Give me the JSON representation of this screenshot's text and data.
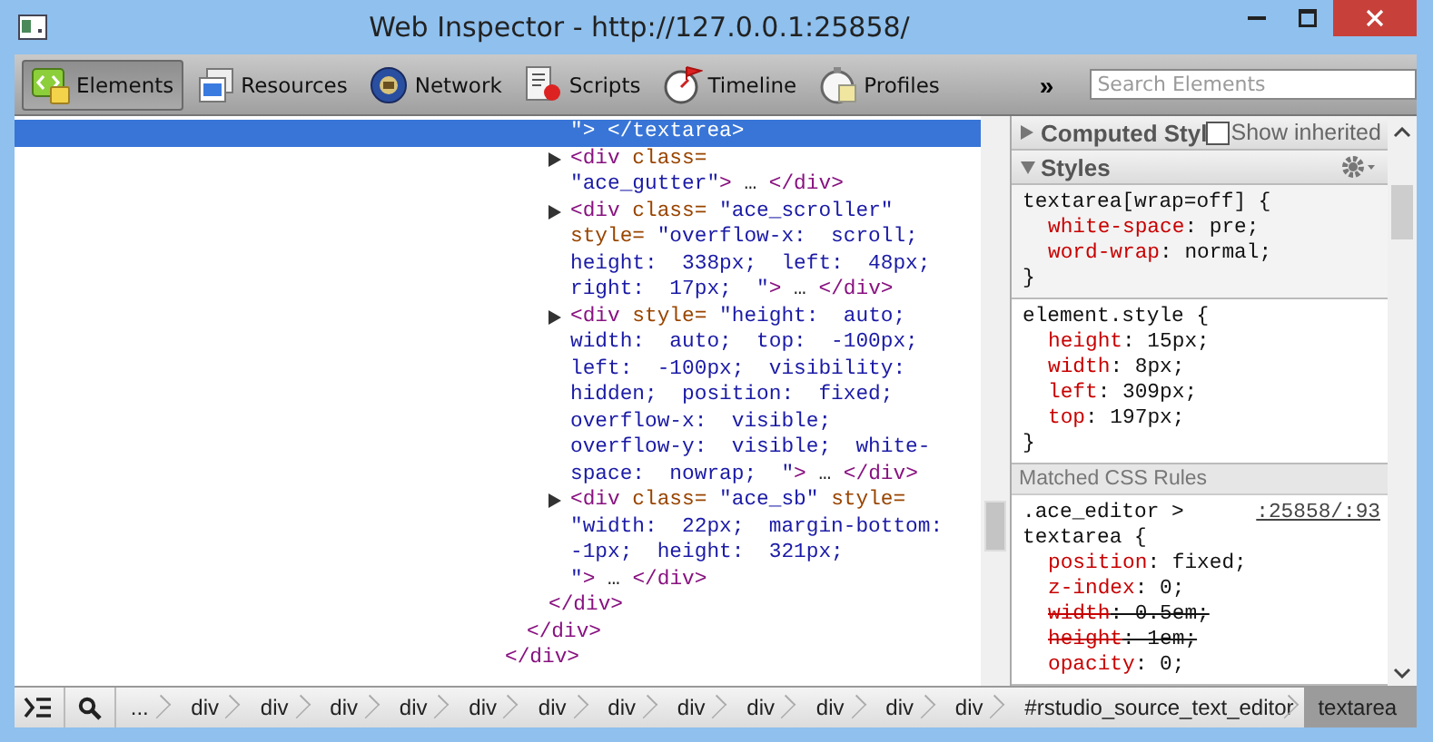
{
  "window": {
    "title": "Web Inspector - http://127.0.0.1:25858/"
  },
  "toolbar": {
    "tabs": [
      {
        "label": "Elements",
        "selected": true
      },
      {
        "label": "Resources",
        "selected": false
      },
      {
        "label": "Network",
        "selected": false
      },
      {
        "label": "Scripts",
        "selected": false
      },
      {
        "label": "Timeline",
        "selected": false
      },
      {
        "label": "Profiles",
        "selected": false
      }
    ],
    "overflow": "»",
    "search": {
      "placeholder": "Search Elements"
    }
  },
  "dom_tree": {
    "close": [
      {
        "kind": "tag",
        "text": "</div>"
      }
    ],
    "children": [
      {
        "close": [
          {
            "kind": "tag",
            "text": "</div>"
          }
        ],
        "children": [
          {
            "close": [
              {
                "kind": "tag",
                "text": "</div>"
              }
            ],
            "children": [
              {
                "selected": true,
                "lines": [
                  [
                    {
                      "kind": "value",
                      "text": "\""
                    },
                    {
                      "kind": "tag",
                      "text": "> </textarea>"
                    }
                  ]
                ]
              },
              {
                "selected": false,
                "expanded": false,
                "lines": [
                  [
                    {
                      "kind": "tag",
                      "text": "<div"
                    },
                    {
                      "kind": "attr",
                      "text": " class="
                    }
                  ],
                  [
                    {
                      "kind": "value",
                      "text": "\"ace_gutter\""
                    },
                    {
                      "kind": "tag",
                      "text": ">"
                    },
                    {
                      "kind": "text",
                      "text": " … "
                    },
                    {
                      "kind": "tag",
                      "text": "</div>"
                    }
                  ]
                ]
              },
              {
                "selected": false,
                "expanded": false,
                "lines": [
                  [
                    {
                      "kind": "tag",
                      "text": "<div"
                    },
                    {
                      "kind": "attr",
                      "text": " class="
                    },
                    {
                      "kind": "value",
                      "text": " \"ace_scroller\""
                    }
                  ],
                  [
                    {
                      "kind": "attr",
                      "text": "style="
                    },
                    {
                      "kind": "value",
                      "text": " \"overflow-x:  scroll;"
                    }
                  ],
                  [
                    {
                      "kind": "value",
                      "text": "height:  338px;  left:  48px;"
                    }
                  ],
                  [
                    {
                      "kind": "value",
                      "text": "right:  17px;  \""
                    },
                    {
                      "kind": "tag",
                      "text": ">"
                    },
                    {
                      "kind": "text",
                      "text": " … "
                    },
                    {
                      "kind": "tag",
                      "text": "</div>"
                    }
                  ]
                ]
              },
              {
                "selected": false,
                "expanded": false,
                "lines": [
                  [
                    {
                      "kind": "tag",
                      "text": "<div"
                    },
                    {
                      "kind": "attr",
                      "text": " style="
                    },
                    {
                      "kind": "value",
                      "text": " \"height:  auto;"
                    }
                  ],
                  [
                    {
                      "kind": "value",
                      "text": "width:  auto;  top:  -100px;"
                    }
                  ],
                  [
                    {
                      "kind": "value",
                      "text": "left:  -100px;  visibility:"
                    }
                  ],
                  [
                    {
                      "kind": "value",
                      "text": "hidden;  position:  fixed;"
                    }
                  ],
                  [
                    {
                      "kind": "value",
                      "text": "overflow-x:  visible;"
                    }
                  ],
                  [
                    {
                      "kind": "value",
                      "text": "overflow-y:  visible;  white-"
                    }
                  ],
                  [
                    {
                      "kind": "value",
                      "text": "space:  nowrap;  \""
                    },
                    {
                      "kind": "tag",
                      "text": ">"
                    },
                    {
                      "kind": "text",
                      "text": " … "
                    },
                    {
                      "kind": "tag",
                      "text": "</div>"
                    }
                  ]
                ]
              },
              {
                "selected": false,
                "expanded": false,
                "lines": [
                  [
                    {
                      "kind": "tag",
                      "text": "<div"
                    },
                    {
                      "kind": "attr",
                      "text": " class="
                    },
                    {
                      "kind": "value",
                      "text": " \"ace_sb\""
                    },
                    {
                      "kind": "attr",
                      "text": " style="
                    }
                  ],
                  [
                    {
                      "kind": "value",
                      "text": "\"width:  22px;  margin-bottom:"
                    }
                  ],
                  [
                    {
                      "kind": "value",
                      "text": "-1px;  height:  321px;"
                    }
                  ],
                  [
                    {
                      "kind": "value",
                      "text": "\""
                    },
                    {
                      "kind": "tag",
                      "text": ">"
                    },
                    {
                      "kind": "text",
                      "text": " … "
                    },
                    {
                      "kind": "tag",
                      "text": "</div>"
                    }
                  ]
                ]
              }
            ]
          }
        ]
      }
    ]
  },
  "styles_pane": {
    "computed": {
      "title": "Computed Styl",
      "expanded": false,
      "show_inherited": {
        "label": "Show inherited",
        "checked": false
      }
    },
    "styles": {
      "title": "Styles",
      "expanded": true
    },
    "blocks": [
      {
        "kind": "rule",
        "shaded": true,
        "selector_lines": [
          "textarea[wrap=off] {"
        ],
        "properties": [
          {
            "name": "white-space",
            "value": ": pre;",
            "overridden": false
          },
          {
            "name": "word-wrap",
            "value": ": normal;",
            "overridden": false
          }
        ],
        "closing": "}"
      },
      {
        "kind": "rule",
        "shaded": false,
        "selector_lines": [
          "element.style {"
        ],
        "properties": [
          {
            "name": "height",
            "value": ": 15px;",
            "overridden": false
          },
          {
            "name": "width",
            "value": ": 8px;",
            "overridden": false
          },
          {
            "name": "left",
            "value": ": 309px;",
            "overridden": false
          },
          {
            "name": "top",
            "value": ": 197px;",
            "overridden": false
          }
        ],
        "closing": "}"
      },
      {
        "kind": "heading",
        "text": "Matched CSS Rules"
      },
      {
        "kind": "rule",
        "shaded": false,
        "selector_lines": [
          ".ace_editor >",
          "textarea {"
        ],
        "source": ":25858/:93",
        "properties": [
          {
            "name": "position",
            "value": ": fixed;",
            "overridden": false
          },
          {
            "name": "z-index",
            "value": ": 0;",
            "overridden": false
          },
          {
            "name": "width",
            "value": ": 0.5em;",
            "overridden": true
          },
          {
            "name": "height",
            "value": ": 1em;",
            "overridden": true
          },
          {
            "name": "opacity",
            "value": ": 0;",
            "overridden": false
          }
        ]
      }
    ]
  },
  "breadcrumbs": [
    {
      "label": "...",
      "selected": false
    },
    {
      "label": "div",
      "selected": false
    },
    {
      "label": "div",
      "selected": false
    },
    {
      "label": "div",
      "selected": false
    },
    {
      "label": "div",
      "selected": false
    },
    {
      "label": "div",
      "selected": false
    },
    {
      "label": "div",
      "selected": false
    },
    {
      "label": "div",
      "selected": false
    },
    {
      "label": "div",
      "selected": false
    },
    {
      "label": "div",
      "selected": false
    },
    {
      "label": "div",
      "selected": false
    },
    {
      "label": "div",
      "selected": false
    },
    {
      "label": "div",
      "selected": false
    },
    {
      "label": "#rstudio_source_text_editor",
      "selected": false
    },
    {
      "label": "textarea",
      "selected": true
    }
  ]
}
